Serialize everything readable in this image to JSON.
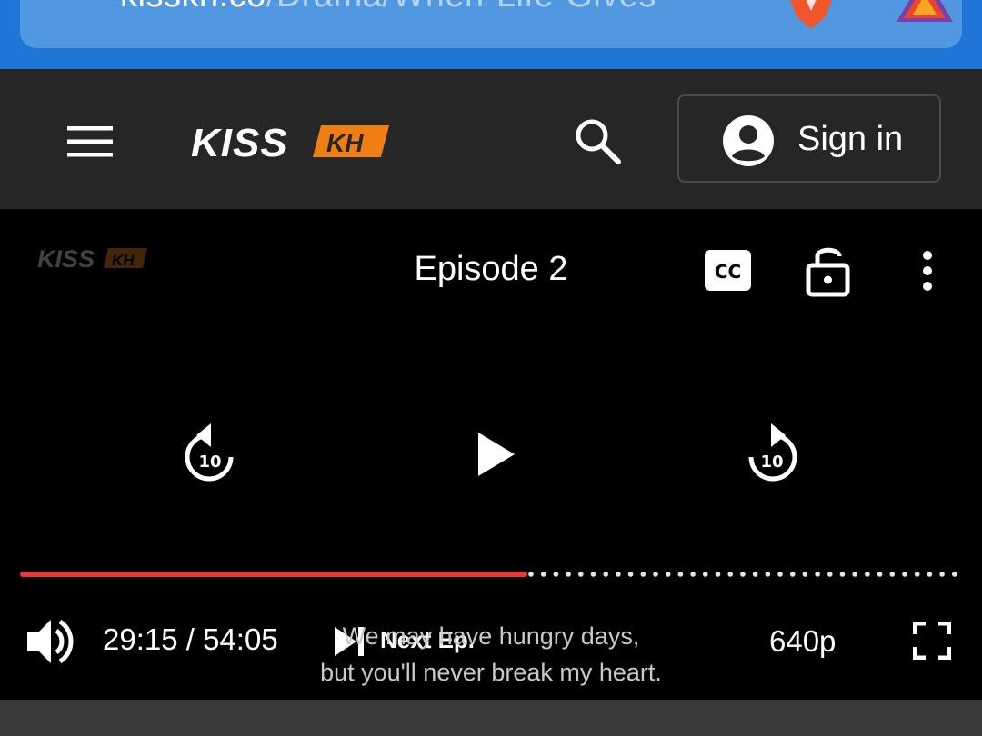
{
  "browser": {
    "url_domain": "kisskh.co",
    "url_path": "/Drama/When-Life-Gives",
    "icons": [
      "site-info-icon",
      "brave-shield-icon",
      "brave-rewards-icon"
    ],
    "colors": {
      "bar": "#1f76d6",
      "pill": "#5298e1"
    }
  },
  "header": {
    "menu_icon": "menu-icon",
    "logo": {
      "word": "KISS",
      "badge": "KH"
    },
    "search_icon": "search-icon",
    "signin_label": "Sign in",
    "colors": {
      "background": "#262626",
      "logo_badge": "#f07f13"
    }
  },
  "player": {
    "watermark": {
      "word": "KISS",
      "badge": "KH"
    },
    "episode_title": "Episode 2",
    "rewind_seconds": "10",
    "forward_seconds": "10",
    "time_display": "29:15 / 54:05",
    "played_fraction": 0.54,
    "next_label": "Next Ep.",
    "subtitle_line1": "We may have hungry days,",
    "subtitle_line2": "but you'll never break my heart.",
    "quality": "640p",
    "colors": {
      "progress_played": "#e53935"
    }
  }
}
